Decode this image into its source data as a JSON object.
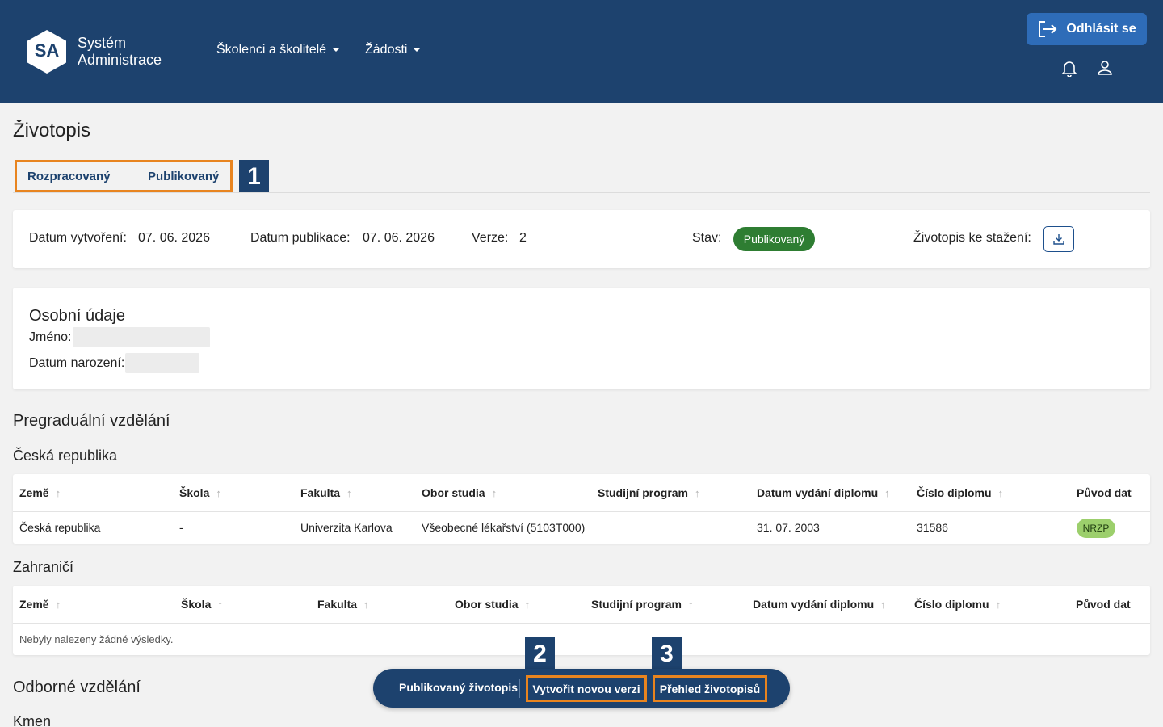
{
  "header": {
    "logo_initials": "SA",
    "logo_line1": "Systém",
    "logo_line2": "Administrace",
    "nav": [
      {
        "label": "Školenci a školitelé"
      },
      {
        "label": "Žádosti"
      }
    ],
    "logout_label": "Odhlásit se",
    "icons": [
      "logout-icon",
      "bell-icon",
      "user-icon"
    ],
    "colors": {
      "header_bg": "#1d426e",
      "logout_bg": "#2e6cb8"
    }
  },
  "page": {
    "title": "Životopis",
    "tabs": [
      "Rozpracovaný",
      "Publikovaný"
    ],
    "callouts": [
      "1",
      "2",
      "3"
    ]
  },
  "meta": {
    "created_label": "Datum vytvoření:",
    "created_value": "07. 06. 2026",
    "published_label": "Datum publikace:",
    "published_value": "07. 06. 2026",
    "version_label": "Verze:",
    "version_value": "2",
    "status_label": "Stav:",
    "status_value": "Publikovaný",
    "download_label": "Životopis ke stažení:",
    "download_icon": "download-icon",
    "status_color": "#2e7d32"
  },
  "personal": {
    "title": "Osobní údaje",
    "name_label": "Jméno:",
    "birth_label": "Datum narození:"
  },
  "education": {
    "title": "Pregraduální vzdělání",
    "czech": {
      "title": "Česká republika",
      "columns": [
        "Země",
        "Škola",
        "Fakulta",
        "Obor studia",
        "Studijní program",
        "Datum vydání diplomu",
        "Číslo diplomu",
        "Původ dat"
      ],
      "rows": [
        [
          "Česká republika",
          "-",
          "Univerzita Karlova",
          "Všeobecné lékařství (5103T000)",
          "",
          "31. 07. 2003",
          "31586",
          "NRZP"
        ]
      ]
    },
    "foreign": {
      "title": "Zahraničí",
      "columns": [
        "Země",
        "Škola",
        "Fakulta",
        "Obor studia",
        "Studijní program",
        "Datum vydání diplomu",
        "Číslo diplomu",
        "Původ dat"
      ],
      "empty": "Nebyly nalezeny žádné výsledky."
    }
  },
  "professional": {
    "title": "Odborné vzdělání",
    "sub": "Kmen"
  },
  "action_bar": {
    "label": "Publikovaný životopis",
    "new_version": "Vytvořit novou verzi",
    "overview": "Přehled životopisů",
    "highlight_color": "#e8841f"
  }
}
